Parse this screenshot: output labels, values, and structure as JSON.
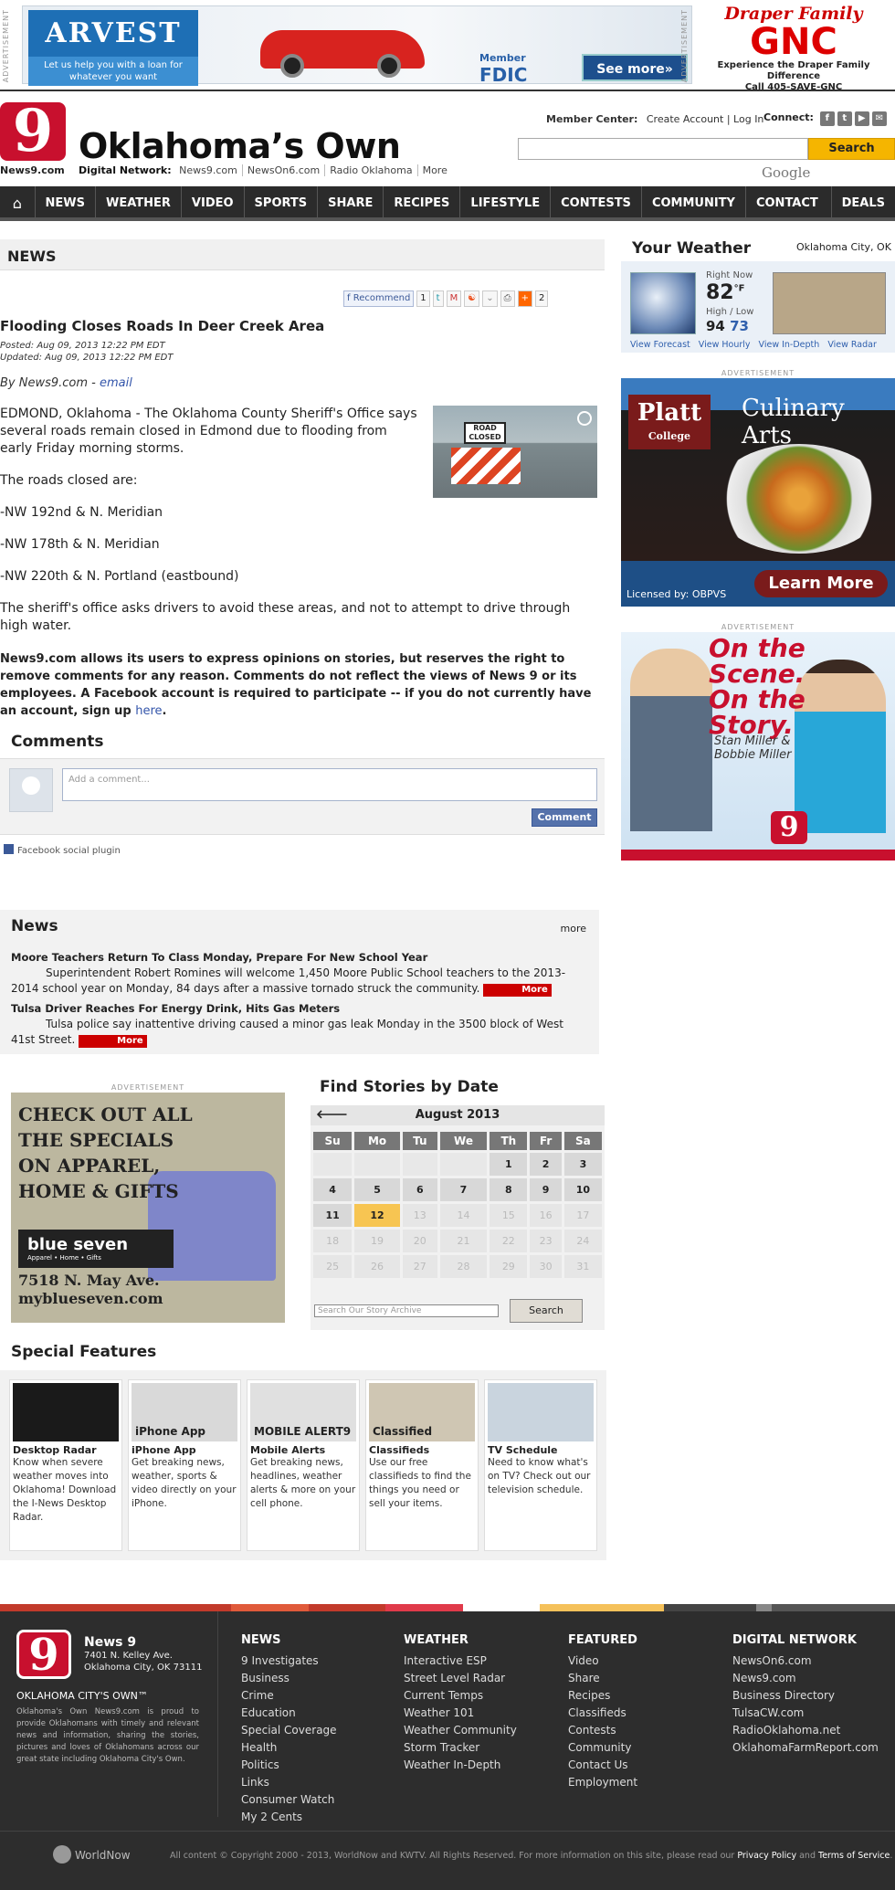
{
  "ads": {
    "label": "ADVERTISEMENT",
    "arvest": {
      "brand": "ARVEST",
      "tagline": "Let us help you with a loan for whatever you want",
      "member": "Member",
      "fdic": "FDIC",
      "cta": "See more»"
    },
    "gnc": {
      "line1": "Draper Family",
      "brand": "GNC",
      "line2": "Experience the Draper Family Difference",
      "line3": "Call 405-SAVE-GNC"
    },
    "platt": {
      "brand": "Platt",
      "sub": "College",
      "title": "Culinary Arts",
      "licensed": "Licensed by: OBPVS",
      "cta": "Learn More"
    },
    "scene": {
      "headline": "On the Scene. On the Story.",
      "names": "Stan Miller & Bobbie Miller",
      "logo": "9"
    },
    "blueseven": {
      "headline": "CHECK OUT ALL THE SPECIALS ON APPAREL, HOME & GIFTS",
      "brand": "blue seven",
      "sub": "Apparel • Home • Gifts",
      "address": "7518 N. May Ave.",
      "url": "myblueseven.com"
    }
  },
  "header": {
    "logo_text": "9",
    "logo_sub": "News9.com",
    "title": "Oklahoma’s Own",
    "digital_network_label": "Digital Network:",
    "network_links": [
      "News9.com",
      "NewsOn6.com",
      "Radio Oklahoma",
      "More"
    ],
    "member_center_label": "Member Center:",
    "create_account": "Create Account",
    "login": "Log In",
    "connect_label": "Connect:",
    "search_button": "Search",
    "search_brand": "Google"
  },
  "nav": {
    "home_icon": "⌂",
    "items": [
      "NEWS",
      "WEATHER",
      "VIDEO",
      "SPORTS",
      "SHARE",
      "RECIPES",
      "LIFESTYLE",
      "CONTESTS",
      "COMMUNITY",
      "CONTACT US",
      "DEALS"
    ]
  },
  "section_title": "NEWS",
  "share": {
    "recommend": "Recommend",
    "recommend_count": "1",
    "plus_count": "2"
  },
  "article": {
    "title": "Flooding Closes Roads In Deer Creek Area",
    "posted": "Posted: Aug 09, 2013 12:22 PM EDT",
    "updated": "Updated: Aug 09, 2013 12:22 PM EDT",
    "byline": "By News9.com - ",
    "email": "email",
    "paragraphs": [
      "EDMOND, Oklahoma - The Oklahoma County Sheriff's Office says several roads remain closed in Edmond due to flooding from early Friday morning storms.",
      "The roads closed are:",
      "-NW 192nd & N. Meridian",
      "-NW 178th & N. Meridian",
      "-NW 220th & N. Portland (eastbound)",
      "The sheriff's office asks drivers to avoid these areas, and not to attempt to drive through high water."
    ],
    "image_sign": "ROAD CLOSED",
    "disclaimer": "News9.com allows its users to express opinions on stories, but reserves the right to remove comments for any reason. Comments do not reflect the views of News 9 or its employees. A Facebook account is required to participate -- if you do not currently have an account, sign up ",
    "disclaimer_link": "here",
    "disclaimer_end": "."
  },
  "comments": {
    "title": "Comments",
    "placeholder": "Add a comment...",
    "button": "Comment",
    "plugin": "Facebook social plugin"
  },
  "news_box": {
    "title": "News",
    "more": "more",
    "more_button": "More",
    "items": [
      {
        "title": "Moore Teachers Return To Class Monday, Prepare For New School Year",
        "desc": "Superintendent Robert Romines will welcome 1,450 Moore Public School teachers to the 2013-2014 school year on Monday, 84 days after a massive tornado struck the community."
      },
      {
        "title": "Tulsa Driver Reaches For Energy Drink, Hits Gas Meters",
        "desc": "Tulsa police say inattentive driving caused a minor gas leak Monday in the 3500 block of West 41st Street."
      }
    ]
  },
  "calendar": {
    "title": "Find Stories by Date",
    "month": "August 2013",
    "prev_icon": "🡐",
    "days": [
      "Su",
      "Mo",
      "Tu",
      "We",
      "Th",
      "Fr",
      "Sa"
    ],
    "weeks": [
      [
        "",
        "",
        "",
        "",
        "1",
        "2",
        "3"
      ],
      [
        "4",
        "5",
        "6",
        "7",
        "8",
        "9",
        "10"
      ],
      [
        "11",
        "12",
        "13",
        "14",
        "15",
        "16",
        "17"
      ],
      [
        "18",
        "19",
        "20",
        "21",
        "22",
        "23",
        "24"
      ],
      [
        "25",
        "26",
        "27",
        "28",
        "29",
        "30",
        "31"
      ]
    ],
    "today": "12",
    "search_placeholder": "Search Our Story Archive",
    "search_button": "Search"
  },
  "special_features": {
    "title": "Special Features",
    "cards": [
      {
        "title": "Desktop Radar",
        "desc": "Know when severe weather moves into Oklahoma! Download the I-News Desktop Radar.",
        "img_label": "",
        "img_color": "#1a1a1a"
      },
      {
        "title": "iPhone App",
        "desc": "Get breaking news, weather, sports & video directly on your iPhone.",
        "img_label": "iPhone App",
        "img_color": "#d9d9d9"
      },
      {
        "title": "Mobile Alerts",
        "desc": "Get breaking news, headlines, weather alerts & more on your cell phone.",
        "img_label": "MOBILE ALERT9",
        "img_color": "#e0e0e0"
      },
      {
        "title": "Classifieds",
        "desc": "Use our free classifieds to find the things you need or sell your items.",
        "img_label": "Classified",
        "img_color": "#cfc6b3"
      },
      {
        "title": "TV Schedule",
        "desc": "Need to know what's on TV? Check out our television schedule.",
        "img_label": "",
        "img_color": "#c9d4de"
      }
    ]
  },
  "weather": {
    "title": "Your Weather",
    "location": "Oklahoma City, OK",
    "now_label": "Right Now",
    "temp": "82",
    "unit": "°F",
    "hl_label": "High / Low",
    "high": "94",
    "low": "73",
    "links": [
      "View Forecast",
      "View Hourly",
      "View In-Depth",
      "View Radar"
    ]
  },
  "footer": {
    "logo_text": "9",
    "name": "News 9",
    "address1": "7401 N. Kelley Ave.",
    "address2": "Oklahoma City, OK 73111",
    "tagline": "OKLAHOMA CITY'S OWN™",
    "about": "Oklahoma's Own News9.com is proud to provide Oklahomans with timely and relevant news and information, sharing the stories, pictures and loves of Oklahomans across our great state including Oklahoma City's Own.",
    "columns": [
      {
        "title": "NEWS",
        "links": [
          "9 Investigates",
          "Business",
          "Crime",
          "Education",
          "Special Coverage",
          "Health",
          "Politics",
          "Links",
          "Consumer Watch",
          "My 2 Cents"
        ]
      },
      {
        "title": "WEATHER",
        "links": [
          "Interactive ESP",
          "Street Level Radar",
          "Current Temps",
          "Weather 101",
          "Weather Community",
          "Storm Tracker",
          "Weather In-Depth"
        ]
      },
      {
        "title": "FEATURED",
        "links": [
          "Video",
          "Share",
          "Recipes",
          "Classifieds",
          "Contests",
          "Community",
          "Contact Us",
          "Employment"
        ]
      },
      {
        "title": "DIGITAL NETWORK",
        "links": [
          "NewsOn6.com",
          "News9.com",
          "Business Directory",
          "TulsaCW.com",
          "RadioOklahoma.net",
          "OklahomaFarmReport.com"
        ]
      }
    ],
    "worldnow": "WorldNow",
    "copyright": "All content © Copyright 2000 - 2013, WorldNow and KWTV. All Rights Reserved. For more information on this site, please read our ",
    "privacy": "Privacy Policy",
    "and": " and ",
    "terms": "Terms of Service",
    "period": "."
  },
  "colors": {
    "brand_red": "#c8102e",
    "nav_bg": "#2b2b2b",
    "search_yellow": "#f5b500",
    "link_blue": "#3355aa"
  }
}
